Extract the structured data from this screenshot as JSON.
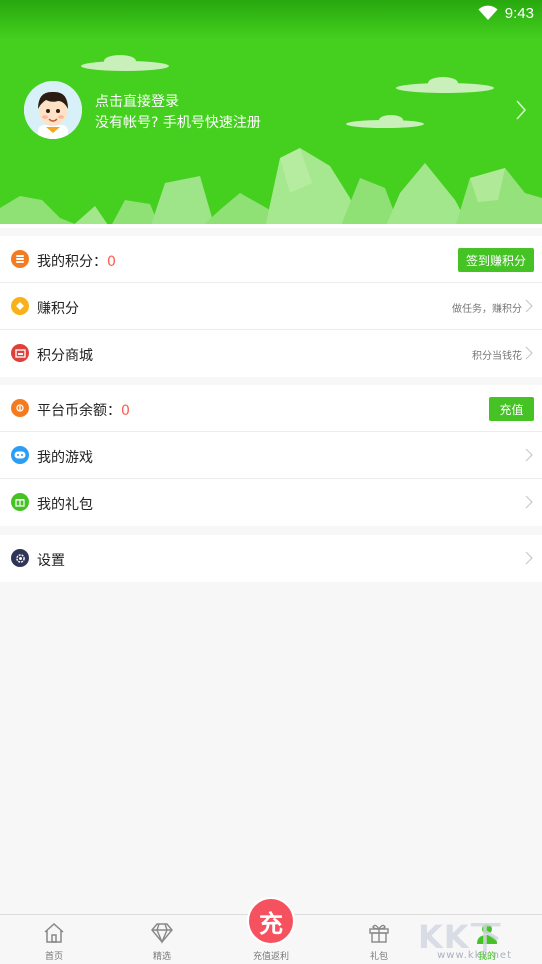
{
  "status_bar": {
    "time": "9:43"
  },
  "header": {
    "login_title": "点击直接登录",
    "login_subtitle": "没有帐号? 手机号快速注册"
  },
  "points_section": {
    "my_points_label": "我的积分：",
    "my_points_value": "0",
    "signin_button": "签到赚积分",
    "earn_label": "赚积分",
    "earn_hint": "做任务，赚积分",
    "mall_label": "积分商城",
    "mall_hint": "积分当钱花"
  },
  "balance_section": {
    "balance_label": "平台币余额：",
    "balance_value": "0",
    "recharge_button": "充值",
    "games_label": "我的游戏",
    "gifts_label": "我的礼包"
  },
  "settings_section": {
    "settings_label": "设置"
  },
  "bottom_nav": {
    "home": "首页",
    "featured": "精选",
    "recharge_icon_text": "充",
    "recharge": "充值返利",
    "gifts": "礼包",
    "mine": "我的"
  },
  "watermark": {
    "big": "KK下载",
    "small": "www.kkx.net"
  },
  "colors": {
    "header_green": "#45d01f",
    "accent_green": "#45c224",
    "value_red": "#ff5a4e",
    "recharge_red": "#f6515f"
  },
  "icons": {
    "my_points": "coin-stack-icon",
    "earn": "diamond-coin-icon",
    "mall": "shop-icon",
    "balance": "platform-coin-icon",
    "games": "gamepad-icon",
    "gifts": "gift-icon",
    "settings": "gear-icon"
  }
}
